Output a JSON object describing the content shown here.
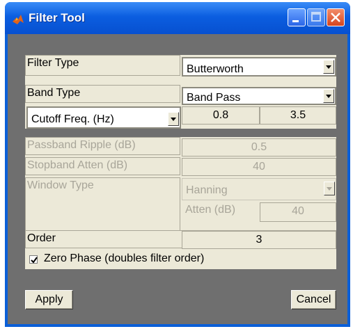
{
  "window": {
    "title": "Filter Tool"
  },
  "filter_type": {
    "label": "Filter Type",
    "value": "Butterworth"
  },
  "band_type": {
    "label": "Band Type",
    "value": "Band Pass"
  },
  "cutoff": {
    "mode": "Cutoff Freq. (Hz)",
    "low": "0.8",
    "high": "3.5"
  },
  "passband_ripple": {
    "label": "Passband Ripple (dB)",
    "value": "0.5"
  },
  "stopband_atten": {
    "label": "Stopband Atten (dB)",
    "value": "40"
  },
  "window_type": {
    "label": "Window Type",
    "value": "Hanning",
    "atten_label": "Atten (dB)",
    "atten_value": "40"
  },
  "order": {
    "label": "Order",
    "value": "3"
  },
  "zero_phase": {
    "label": "Zero Phase (doubles filter order)",
    "checked": true
  },
  "buttons": {
    "apply": "Apply",
    "cancel": "Cancel"
  }
}
